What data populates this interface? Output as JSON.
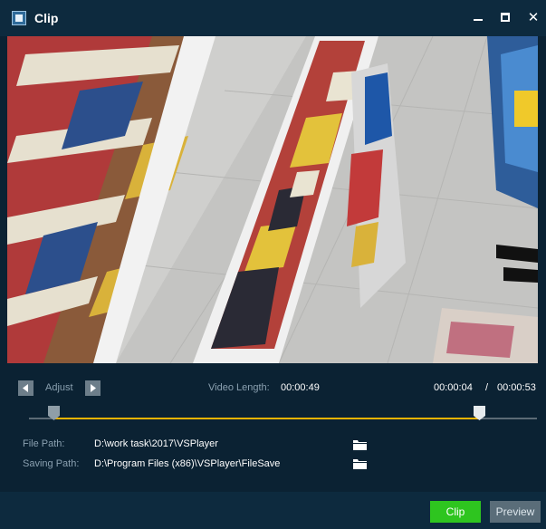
{
  "window": {
    "title": "Clip",
    "controls": [
      "minimize-icon",
      "maximize-icon",
      "close-icon"
    ]
  },
  "video": {
    "description_icon": "video-frame"
  },
  "adjust": {
    "label": "Adjust",
    "left_icon": "triangle-left-icon",
    "right_icon": "triangle-right-icon"
  },
  "clip_info": {
    "video_length_label": "Video Length:",
    "video_length_value": "00:00:49",
    "current_time": "00:00:04",
    "separator": "/",
    "total_time": "00:00:53"
  },
  "timeline": {
    "start_fraction": 0.05,
    "end_fraction": 0.89
  },
  "paths": {
    "file_path_label": "File Path:",
    "file_path_value": "D:\\work task\\2017\\VSPlayer",
    "saving_path_label": "Saving Path:",
    "saving_path_value": "D:\\Program Files (x86)\\VSPlayer\\FileSave"
  },
  "buttons": {
    "clip": "Clip",
    "preview": "Preview"
  },
  "colors": {
    "accent_timeline": "#f0b400",
    "clip_button": "#2ec51f",
    "background": "#0b2233"
  }
}
